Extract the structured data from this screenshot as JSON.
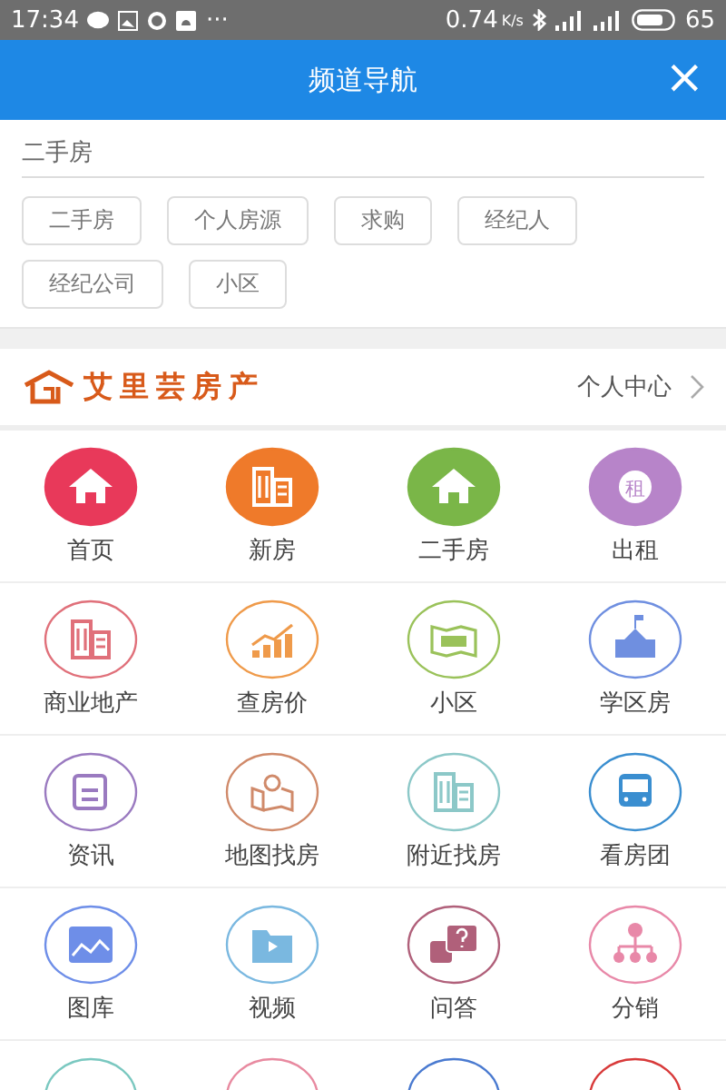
{
  "status_bar": {
    "time": "17:34",
    "more": "···",
    "speed": "0.74",
    "speed_unit": "K/s",
    "battery": "65"
  },
  "header": {
    "title": "频道导航",
    "close": "×"
  },
  "search": {
    "value": "二手房"
  },
  "chips": [
    {
      "label": "二手房"
    },
    {
      "label": "个人房源"
    },
    {
      "label": "求购"
    },
    {
      "label": "经纪人"
    },
    {
      "label": "经纪公司"
    },
    {
      "label": "小区"
    }
  ],
  "brand": {
    "name": "艾里芸房产",
    "link": "个人中心"
  },
  "menu_rows": [
    {
      "items": [
        {
          "label": "首页",
          "kind": "home",
          "filled": true,
          "color": "#e8395a"
        },
        {
          "label": "新房",
          "kind": "building",
          "filled": true,
          "color": "#ef7a2a"
        },
        {
          "label": "二手房",
          "kind": "home",
          "filled": true,
          "color": "#7ab648"
        },
        {
          "label": "出租",
          "kind": "rent",
          "filled": true,
          "color": "#b784c9",
          "icon_text": "租"
        }
      ]
    },
    {
      "items": [
        {
          "label": "商业地产",
          "kind": "building",
          "filled": false,
          "color": "#e0707a"
        },
        {
          "label": "查房价",
          "kind": "chart",
          "filled": false,
          "color": "#ef9a4a"
        },
        {
          "label": "小区",
          "kind": "map",
          "filled": false,
          "color": "#9ac25a"
        },
        {
          "label": "学区房",
          "kind": "school",
          "filled": false,
          "color": "#6f8fe0"
        }
      ]
    },
    {
      "items": [
        {
          "label": "资讯",
          "kind": "news",
          "filled": false,
          "color": "#9a7ac0"
        },
        {
          "label": "地图找房",
          "kind": "pin",
          "filled": false,
          "color": "#d08a6a"
        },
        {
          "label": "附近找房",
          "kind": "building",
          "filled": false,
          "color": "#8cc8c8"
        },
        {
          "label": "看房团",
          "kind": "bus",
          "filled": false,
          "color": "#3a8ed0"
        }
      ]
    },
    {
      "items": [
        {
          "label": "图库",
          "kind": "gallery",
          "filled": false,
          "color": "#6e8ee8"
        },
        {
          "label": "视频",
          "kind": "video",
          "filled": false,
          "color": "#7ab8e0"
        },
        {
          "label": "问答",
          "kind": "qa",
          "filled": false,
          "color": "#b0607a"
        },
        {
          "label": "分销",
          "kind": "share",
          "filled": false,
          "color": "#e888a8"
        }
      ]
    },
    {
      "items": [
        {
          "kind": "cut",
          "filled": false,
          "color": "#7ac8c0"
        },
        {
          "kind": "cut",
          "filled": false,
          "color": "#e88aa0"
        },
        {
          "kind": "cut",
          "filled": false,
          "color": "#4a7ad0"
        },
        {
          "kind": "cut",
          "filled": false,
          "color": "#d83a3a"
        }
      ]
    }
  ]
}
